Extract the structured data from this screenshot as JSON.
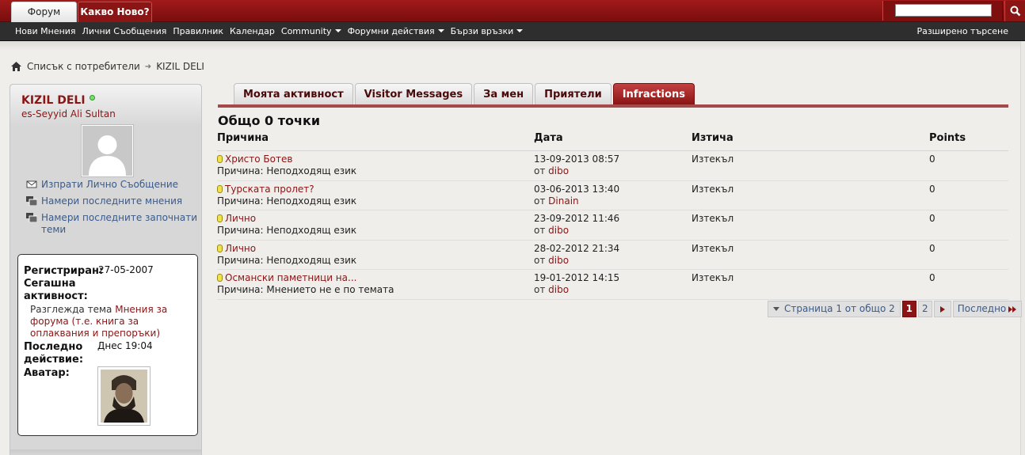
{
  "top_tabs": {
    "forum": "Форум",
    "whats_new": "Какво Ново?"
  },
  "search": {
    "value": "",
    "placeholder": ""
  },
  "nav": {
    "items": [
      {
        "label": "Нови Мнения"
      },
      {
        "label": "Лични Съобщения"
      },
      {
        "label": "Правилник"
      },
      {
        "label": "Календар"
      },
      {
        "label": "Community"
      },
      {
        "label": "Форумни действия"
      },
      {
        "label": "Бързи връзки"
      }
    ],
    "advanced_search": "Разширено търсене"
  },
  "breadcrumb": {
    "members_list": "Списък с потребители",
    "current": "KIZIL DELI"
  },
  "profile": {
    "name": "KIZIL DELI",
    "title": "es-Seyyid Ali Sultan",
    "links": [
      {
        "label": "Изпрати Лично Съобщение",
        "icon": "envelope-icon"
      },
      {
        "label": "Намери последните мнения",
        "icon": "posts-icon"
      },
      {
        "label": "Намери последните започнати теми",
        "icon": "threads-icon"
      }
    ],
    "info": {
      "registered_label": "Регистриран:",
      "registered_value": "27-05-2007",
      "current_activity_label": "Сегашна активност:",
      "activity_prefix": "Разглежда тема",
      "activity_link": "Мнения за форума (т.е. книга за оплаквания и препоръки)",
      "last_activity_label": "Последно действие:",
      "last_activity_value": "Днес 19:04",
      "avatar_label": "Аватар:"
    }
  },
  "tabs": [
    {
      "label": "Моята активност",
      "active": false
    },
    {
      "label": "Visitor Messages",
      "active": false
    },
    {
      "label": "За мен",
      "active": false
    },
    {
      "label": "Приятели",
      "active": false
    },
    {
      "label": "Infractions",
      "active": true
    }
  ],
  "infractions": {
    "total": "Общо 0 точки",
    "columns": {
      "reason": "Причина",
      "date": "Дата",
      "expires": "Изтича",
      "points": "Points"
    },
    "rows": [
      {
        "title": "Христо Ботев",
        "reason": "Причина: Неподходящ език",
        "date": "13-09-2013 08:57",
        "by_prefix": "от",
        "by": "dibo",
        "expires": "Изтекъл",
        "points": "0"
      },
      {
        "title": "Турската пролет?",
        "reason": "Причина: Неподходящ език",
        "date": "03-06-2013 13:40",
        "by_prefix": "от",
        "by": "Dinain",
        "expires": "Изтекъл",
        "points": "0"
      },
      {
        "title": "Лично",
        "reason": "Причина: Неподходящ език",
        "date": "23-09-2012 11:46",
        "by_prefix": "от",
        "by": "dibo",
        "expires": "Изтекъл",
        "points": "0"
      },
      {
        "title": "Лично",
        "reason": "Причина: Неподходящ език",
        "date": "28-02-2012 21:34",
        "by_prefix": "от",
        "by": "dibo",
        "expires": "Изтекъл",
        "points": "0"
      },
      {
        "title": "Османски паметници на...",
        "reason": "Причина: Мнението не е по темата",
        "date": "19-01-2012 14:15",
        "by_prefix": "от",
        "by": "dibo",
        "expires": "Изтекъл",
        "points": "0"
      }
    ]
  },
  "pager": {
    "info": "Страница 1 от общо 2",
    "pages": [
      "1",
      "2"
    ],
    "last": "Последно"
  },
  "colors": {
    "brand_red": "#8b1414",
    "nav_dark": "#2e2e2e",
    "link_blue": "#3a5a8a"
  }
}
